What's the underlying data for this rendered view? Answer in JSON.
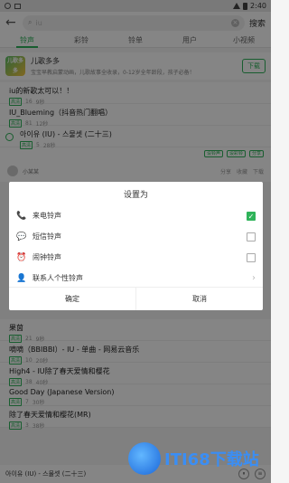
{
  "status": {
    "time": "2:40"
  },
  "search": {
    "back": "←",
    "value": "iu",
    "submit": "搜索"
  },
  "tabs": [
    {
      "label": "铃声",
      "active": true
    },
    {
      "label": "彩铃",
      "active": false
    },
    {
      "label": "铃单",
      "active": false
    },
    {
      "label": "用户",
      "active": false
    },
    {
      "label": "小视频",
      "active": false
    }
  ],
  "banner": {
    "logo": "儿歌多多",
    "title": "儿歌多多",
    "subtitle": "宝宝早教启蒙动画，儿歌故事全收录，0-12岁全年龄段，孩子必备！",
    "button": "下载"
  },
  "songs_top": [
    {
      "title": "iu的新歌太可以！！",
      "tag": "高清",
      "plays": "16",
      "dur": "9秒"
    },
    {
      "title": "IU_Blueming（抖音热门翻唱）",
      "tag": "高清",
      "plays": "81",
      "dur": "12秒"
    },
    {
      "title": "아이유 (IU) - 스물셋 (二十三)",
      "tag": "高清",
      "plays": "5",
      "dur": "28秒"
    }
  ],
  "row_actions": [
    "设铃声",
    "设彩铃",
    "分享"
  ],
  "user": {
    "name": "小某某",
    "stats": [
      "分享",
      "收藏",
      "下载"
    ]
  },
  "dialog": {
    "title": "设置为",
    "items": [
      {
        "icon": "phone-icon",
        "glyph": "📞",
        "label": "来电铃声",
        "control": "checkbox",
        "checked": true
      },
      {
        "icon": "sms-icon",
        "glyph": "💬",
        "label": "短信铃声",
        "control": "checkbox",
        "checked": false
      },
      {
        "icon": "alarm-icon",
        "glyph": "⏰",
        "label": "闹钟铃声",
        "control": "checkbox",
        "checked": false
      },
      {
        "icon": "contact-icon",
        "glyph": "👤",
        "label": "联系人个性铃声",
        "control": "chevron",
        "checked": false
      }
    ],
    "confirm": "确定",
    "cancel": "取消"
  },
  "songs_bottom": [
    {
      "title": "果茵",
      "tag": "高清",
      "plays": "21",
      "dur": "9秒"
    },
    {
      "title": "嘀嘀（BBIBBI）- IU - 单曲 - 网易云音乐",
      "tag": "高清",
      "plays": "10",
      "dur": "20秒"
    },
    {
      "title": "High4 - IU除了春天爱情和樱花",
      "tag": "高清",
      "plays": "38",
      "dur": "40秒"
    },
    {
      "title": "Good Day (Japanese Version)",
      "tag": "高清",
      "plays": "7",
      "dur": "30秒"
    },
    {
      "title": "除了春天爱情和樱花(MR)",
      "tag": "高清",
      "plays": "3",
      "dur": "38秒"
    }
  ],
  "player": {
    "title": "아이유 (IU) - 스물셋 (二十三)",
    "play": "⏸",
    "list": "≡"
  },
  "watermark": "ITI68下载站",
  "colors": {
    "accent": "#2fb35a"
  }
}
